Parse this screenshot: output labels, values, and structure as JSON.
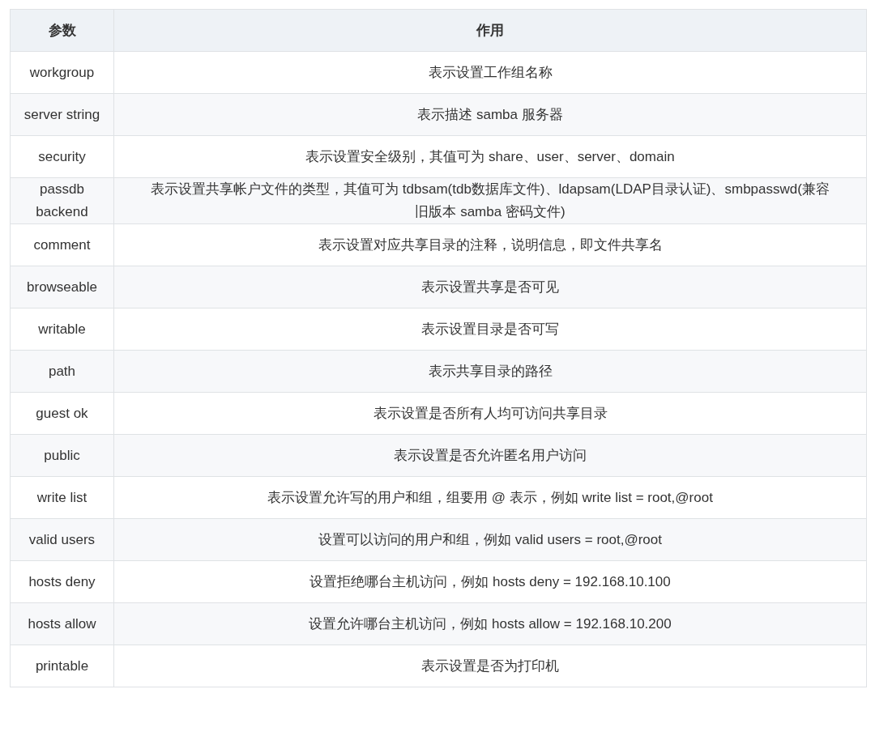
{
  "table": {
    "columns": [
      "参数",
      "作用"
    ],
    "rows": [
      [
        "workgroup",
        "表示设置工作组名称"
      ],
      [
        "server string",
        "表示描述 samba 服务器"
      ],
      [
        "security",
        "表示设置安全级别，其值可为 share、user、server、domain"
      ],
      [
        "passdb backend",
        "表示设置共享帐户文件的类型，其值可为 tdbsam(tdb数据库文件)、ldapsam(LDAP目录认证)、smbpasswd(兼容旧版本 samba 密码文件)"
      ],
      [
        "comment",
        "表示设置对应共享目录的注释，说明信息，即文件共享名"
      ],
      [
        "browseable",
        "表示设置共享是否可见"
      ],
      [
        "writable",
        "表示设置目录是否可写"
      ],
      [
        "path",
        "表示共享目录的路径"
      ],
      [
        "guest ok",
        "表示设置是否所有人均可访问共享目录"
      ],
      [
        "public",
        "表示设置是否允许匿名用户访问"
      ],
      [
        "write list",
        "表示设置允许写的用户和组，组要用 @ 表示，例如 write list = root,@root"
      ],
      [
        "valid users",
        "设置可以访问的用户和组，例如 valid users = root,@root"
      ],
      [
        "hosts deny",
        "设置拒绝哪台主机访问，例如 hosts deny = 192.168.10.100"
      ],
      [
        "hosts allow",
        "设置允许哪台主机访问，例如 hosts allow = 192.168.10.200"
      ],
      [
        "printable",
        "表示设置是否为打印机"
      ]
    ]
  }
}
